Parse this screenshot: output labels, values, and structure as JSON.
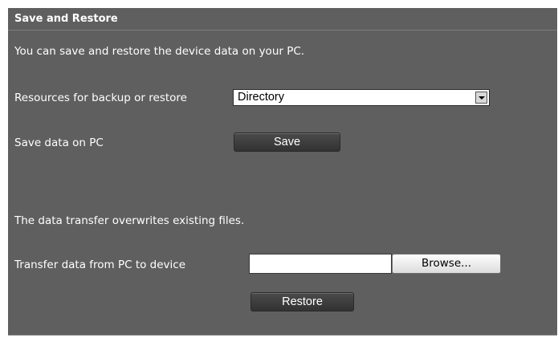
{
  "section": {
    "title": "Save and Restore",
    "intro": "You can save and restore the device data on your PC."
  },
  "backup": {
    "resources_label": "Resources for backup or restore",
    "resources_selected": "Directory",
    "save_label": "Save data on PC",
    "save_button": "Save"
  },
  "restore": {
    "warning": "The data transfer overwrites existing files.",
    "transfer_label": "Transfer data from PC to device",
    "file_value": "",
    "browse_button": "Browse...",
    "restore_button": "Restore"
  },
  "icons": {
    "dropdown": "chevron-down-icon"
  }
}
